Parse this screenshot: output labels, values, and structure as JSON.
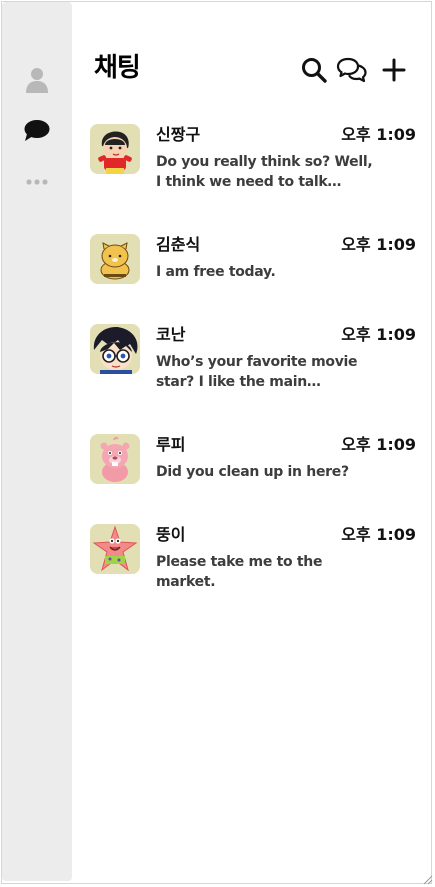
{
  "header": {
    "title": "채팅",
    "icons": [
      "search-icon",
      "new-chat-icon",
      "plus-icon"
    ]
  },
  "sidebar": {
    "items": [
      {
        "icon": "person-icon",
        "active": false
      },
      {
        "icon": "chat-bubble-icon",
        "active": true
      },
      {
        "icon": "more-icon",
        "active": false
      }
    ]
  },
  "chats": [
    {
      "name": "신짱구",
      "time": "오후 1:09",
      "message": "Do you really think so? Well, I think we need to talk about it.",
      "avatar": "shinchan-avatar"
    },
    {
      "name": "김춘식",
      "time": "오후 1:09",
      "message": "I am free today.",
      "avatar": "choonsik-avatar"
    },
    {
      "name": "코난",
      "time": "오후 1:09",
      "message": "Who’s your favorite movie star? I like the main character...",
      "avatar": "conan-avatar"
    },
    {
      "name": "루피",
      "time": "오후 1:09",
      "message": "Did you clean up in here?",
      "avatar": "loopy-avatar"
    },
    {
      "name": "뚱이",
      "time": "오후 1:09",
      "message": "Please take me to the market.",
      "avatar": "patrick-avatar"
    }
  ],
  "colors": {
    "sidebar_bg": "#ececec",
    "avatar_bg": "#e3dfb4",
    "icon_inactive": "#b8b8b8",
    "icon_active": "#111111"
  }
}
